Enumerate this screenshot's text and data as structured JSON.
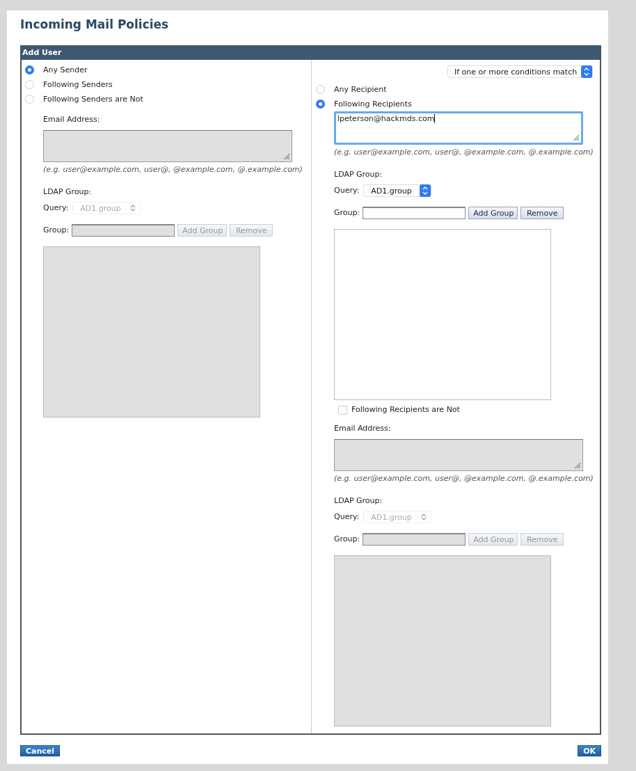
{
  "page_title": "Incoming Mail Policies",
  "panel_title": "Add User",
  "senders": {
    "options": [
      {
        "label": "Any Sender",
        "selected": true
      },
      {
        "label": "Following Senders",
        "selected": false
      },
      {
        "label": "Following Senders are Not",
        "selected": false
      }
    ],
    "block": {
      "email_label": "Email Address:",
      "focused": false,
      "disabled": true,
      "hint": "(e.g. user@example.com, user@, @example.com, @.example.com)",
      "ldap_label": "LDAP Group:",
      "query_label": "Query:",
      "query_value": "AD1.group",
      "group_label": "Group:",
      "add_label": "Add Group",
      "remove_label": "Remove"
    }
  },
  "recipients": {
    "match_mode": "If one or more conditions match",
    "options": [
      {
        "label": "Any Recipient",
        "selected": false
      },
      {
        "label": "Following Recipients",
        "selected": true
      }
    ],
    "block": {
      "email_value": "lpeterson@hackmds.com",
      "focused": true,
      "disabled": false,
      "hint": "(e.g. user@example.com, user@, @example.com, @.example.com)",
      "ldap_label": "LDAP Group:",
      "query_label": "Query:",
      "query_value": "AD1.group",
      "group_label": "Group:",
      "add_label": "Add Group",
      "remove_label": "Remove"
    },
    "exclusion": {
      "label": "Following Recipients are Not",
      "checked": false,
      "email_label": "Email Address:",
      "focused": false,
      "disabled": true,
      "hint": "(e.g. user@example.com, user@, @example.com, @.example.com)",
      "ldap_label": "LDAP Group:",
      "query_label": "Query:",
      "query_value": "AD1.group",
      "group_label": "Group:",
      "add_label": "Add Group",
      "remove_label": "Remove"
    }
  },
  "buttons": [
    {
      "label": "Cancel",
      "kind": "left"
    },
    {
      "label": "OK",
      "kind": "right"
    }
  ]
}
